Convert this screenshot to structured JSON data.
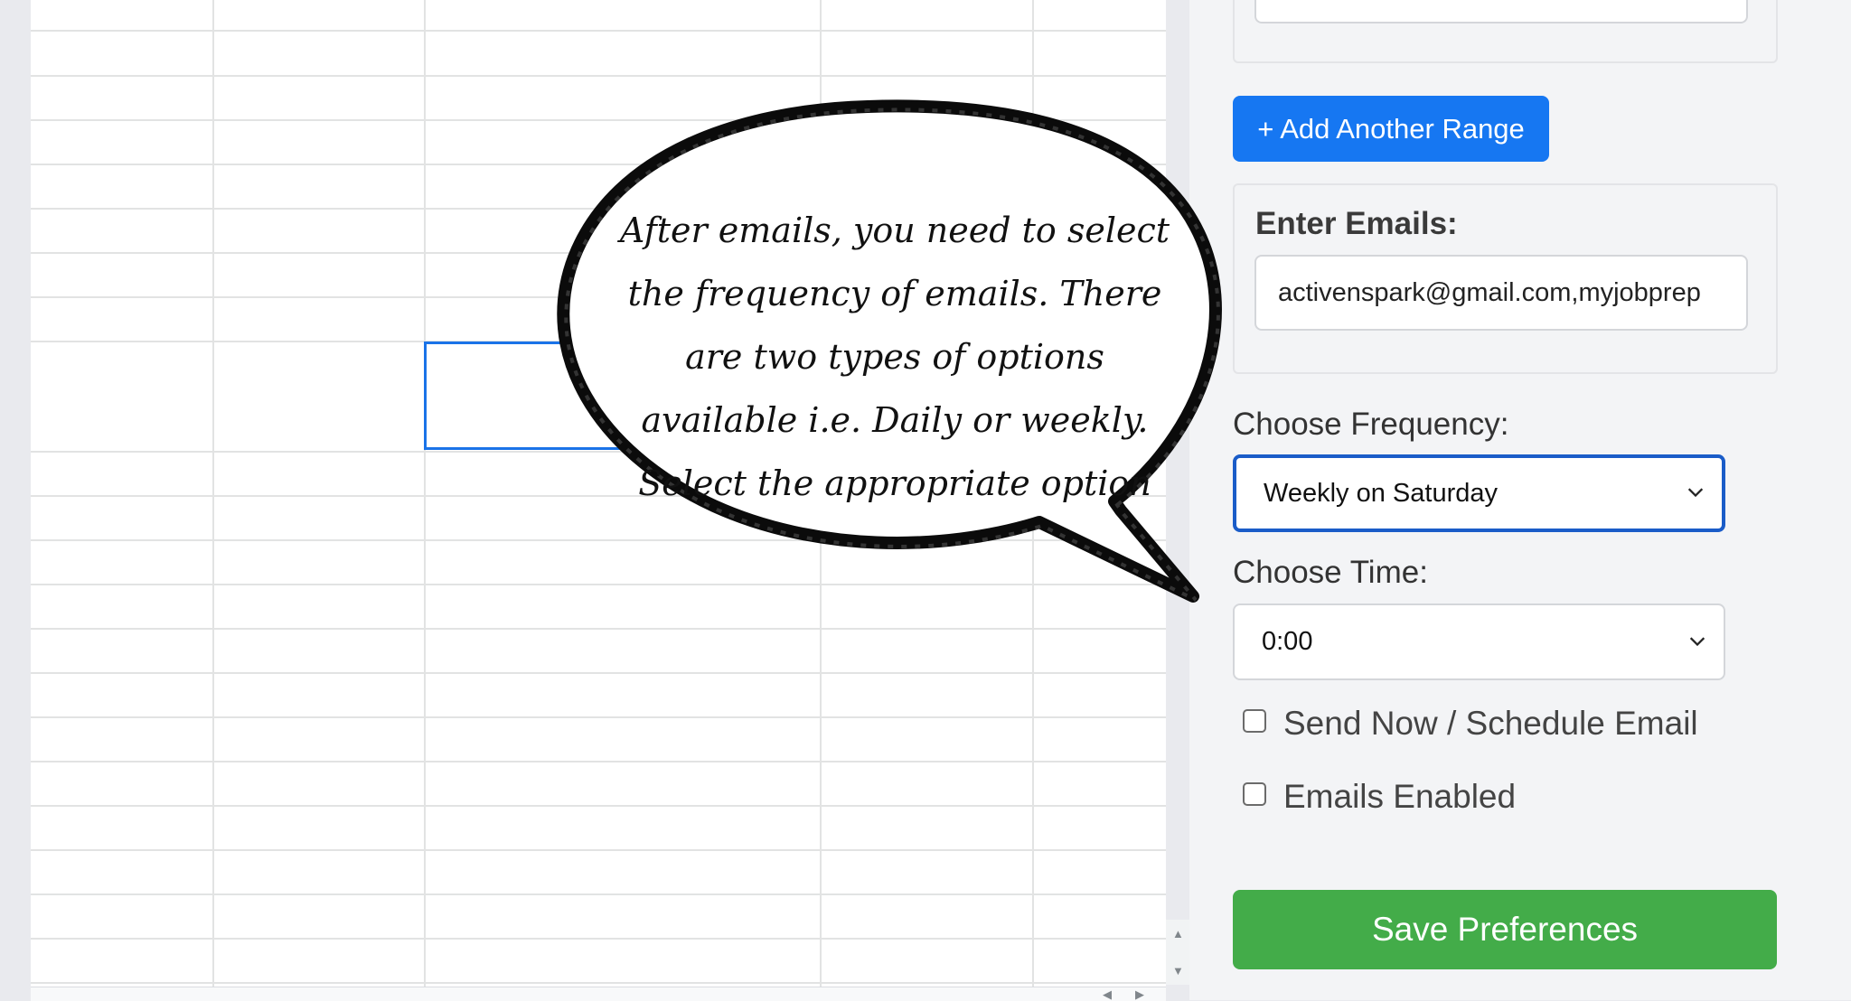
{
  "panel": {
    "add_range_label": "+ Add Another Range",
    "emails_label": "Enter Emails:",
    "emails_value": "activenspark@gmail.com,myjobprep",
    "frequency_label": "Choose Frequency:",
    "frequency_value": "Weekly on Saturday",
    "time_label": "Choose Time:",
    "time_value": "0:00",
    "send_now_label": "Send Now / Schedule Email",
    "send_now_checked": false,
    "emails_enabled_label": "Emails Enabled",
    "emails_enabled_checked": false,
    "save_label": "Save Preferences"
  },
  "callout": {
    "text": "After emails, you need to select the frequency of emails. There are two types of options available i.e. Daily or weekly. Select the appropriate option"
  },
  "colors": {
    "add_button": "#1677f2",
    "save_button": "#43ac49",
    "focus_border": "#1a5cc8",
    "selection": "#1a73e8"
  },
  "icons": {
    "frequency_dropdown": "chevron-down-icon",
    "time_dropdown": "chevron-down-icon",
    "scroll_up": "triangle-up-icon",
    "scroll_down": "triangle-down-icon",
    "scroll_left": "triangle-left-icon",
    "scroll_right": "triangle-right-icon"
  }
}
